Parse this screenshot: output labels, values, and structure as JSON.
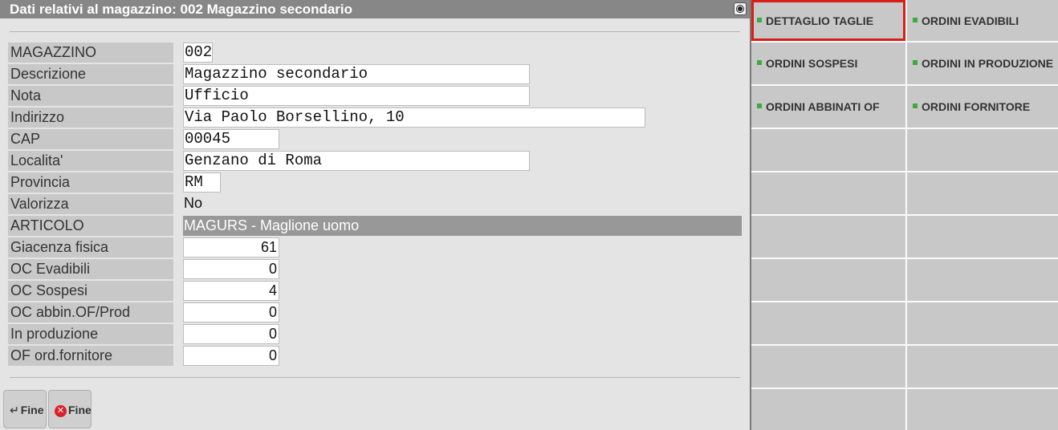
{
  "window": {
    "title": "Dati relativi al magazzino: 002 Magazzino secondario"
  },
  "fields": [
    {
      "label": "MAGAZZINO",
      "value": "002"
    },
    {
      "label": "Descrizione",
      "value": "Magazzino secondario"
    },
    {
      "label": "Nota",
      "value": "Ufficio"
    },
    {
      "label": "Indirizzo",
      "value": "Via Paolo Borsellino, 10"
    },
    {
      "label": "CAP",
      "value": "00045"
    },
    {
      "label": "Localita'",
      "value": "Genzano di Roma"
    },
    {
      "label": "Provincia",
      "value": "RM"
    },
    {
      "label": "Valorizza",
      "value": "No"
    }
  ],
  "articolo": {
    "label": "ARTICOLO",
    "value": "MAGURS - Maglione uomo"
  },
  "quantities": [
    {
      "label": "Giacenza fisica",
      "value": "61"
    },
    {
      "label": "OC Evadibili",
      "value": "0"
    },
    {
      "label": "OC Sospesi",
      "value": "4"
    },
    {
      "label": "OC abbin.OF/Prod",
      "value": "0"
    },
    {
      "label": "In produzione",
      "value": "0"
    },
    {
      "label": "OF ord.fornitore",
      "value": "0"
    }
  ],
  "footer": {
    "buttons": [
      {
        "label": "Fine",
        "icon": "return-arrow-icon"
      },
      {
        "label": "Fine",
        "icon": "close-x-icon"
      }
    ]
  },
  "side_buttons": [
    {
      "label": "DETTAGLIO TAGLIE",
      "selected": true
    },
    {
      "label": "ORDINI EVADIBILI"
    },
    {
      "label": "ORDINI SOSPESI"
    },
    {
      "label": "ORDINI IN PRODUZIONE"
    },
    {
      "label": "ORDINI ABBINATI OF"
    },
    {
      "label": "ORDINI FORNITORE"
    }
  ],
  "colors": {
    "title_bar": "#878787",
    "selection_border": "#d91e18",
    "indicator": "#3cab3c",
    "articolo_bar": "#989898"
  }
}
